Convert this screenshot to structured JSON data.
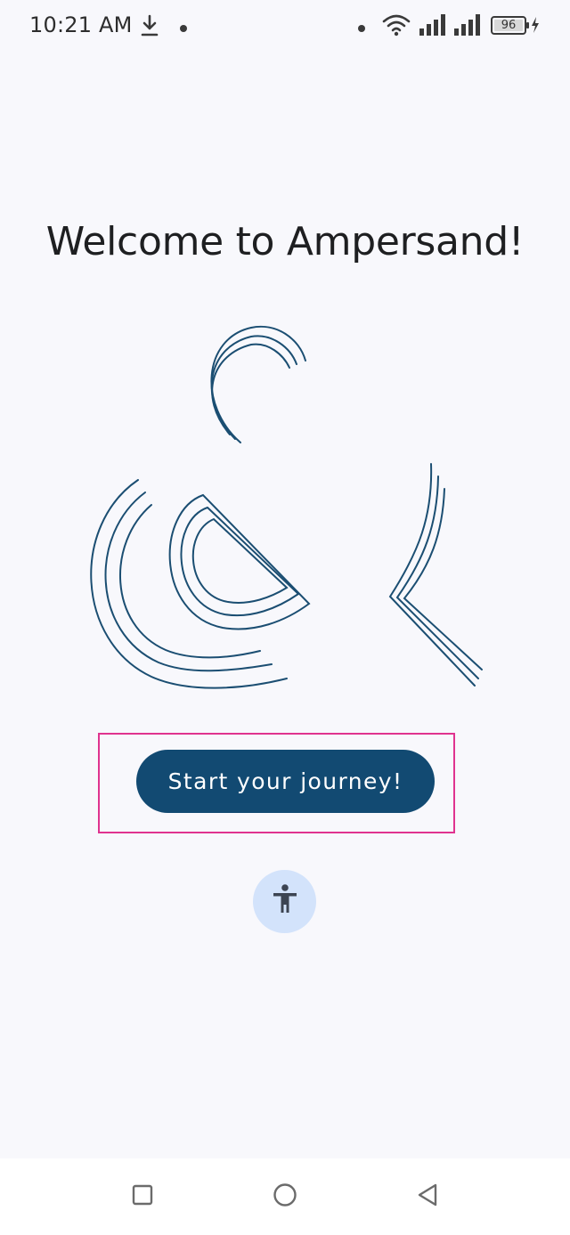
{
  "status_bar": {
    "time": "10:21 AM",
    "battery_level": "96",
    "icons": [
      "download-icon",
      "notification-dot-icon",
      "dot-icon",
      "wifi-icon",
      "signal-icon",
      "signal-icon",
      "battery-icon",
      "charging-icon"
    ]
  },
  "main": {
    "title": "Welcome to Ampersand!",
    "start_button_label": "Start your journey!",
    "accessibility_icon": "accessibility-icon",
    "logo_icon": "ampersand-logo-icon"
  },
  "nav_bar": {
    "icons": [
      "recent-apps-icon",
      "home-icon",
      "back-icon"
    ]
  },
  "colors": {
    "background": "#f8f8fc",
    "primary": "#124a72",
    "accessibility_bg": "#d3e3fb",
    "highlight": "#e0338f",
    "logo_stroke": "#1b4e72"
  }
}
